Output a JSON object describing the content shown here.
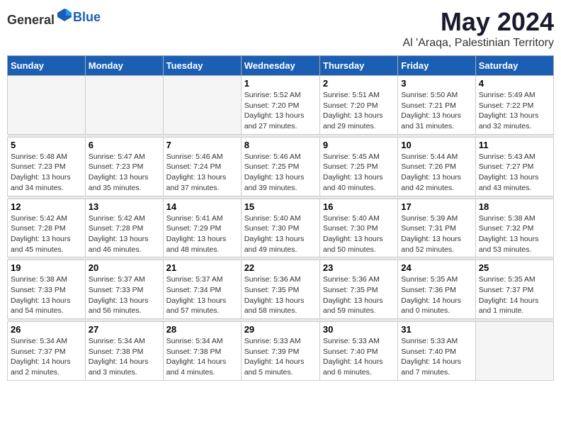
{
  "header": {
    "logo_general": "General",
    "logo_blue": "Blue",
    "title": "May 2024",
    "location": "Al 'Araqa, Palestinian Territory"
  },
  "weekdays": [
    "Sunday",
    "Monday",
    "Tuesday",
    "Wednesday",
    "Thursday",
    "Friday",
    "Saturday"
  ],
  "weeks": [
    [
      {
        "day": "",
        "sunrise": "",
        "sunset": "",
        "daylight": ""
      },
      {
        "day": "",
        "sunrise": "",
        "sunset": "",
        "daylight": ""
      },
      {
        "day": "",
        "sunrise": "",
        "sunset": "",
        "daylight": ""
      },
      {
        "day": "1",
        "sunrise": "Sunrise: 5:52 AM",
        "sunset": "Sunset: 7:20 PM",
        "daylight": "Daylight: 13 hours and 27 minutes."
      },
      {
        "day": "2",
        "sunrise": "Sunrise: 5:51 AM",
        "sunset": "Sunset: 7:20 PM",
        "daylight": "Daylight: 13 hours and 29 minutes."
      },
      {
        "day": "3",
        "sunrise": "Sunrise: 5:50 AM",
        "sunset": "Sunset: 7:21 PM",
        "daylight": "Daylight: 13 hours and 31 minutes."
      },
      {
        "day": "4",
        "sunrise": "Sunrise: 5:49 AM",
        "sunset": "Sunset: 7:22 PM",
        "daylight": "Daylight: 13 hours and 32 minutes."
      }
    ],
    [
      {
        "day": "5",
        "sunrise": "Sunrise: 5:48 AM",
        "sunset": "Sunset: 7:23 PM",
        "daylight": "Daylight: 13 hours and 34 minutes."
      },
      {
        "day": "6",
        "sunrise": "Sunrise: 5:47 AM",
        "sunset": "Sunset: 7:23 PM",
        "daylight": "Daylight: 13 hours and 35 minutes."
      },
      {
        "day": "7",
        "sunrise": "Sunrise: 5:46 AM",
        "sunset": "Sunset: 7:24 PM",
        "daylight": "Daylight: 13 hours and 37 minutes."
      },
      {
        "day": "8",
        "sunrise": "Sunrise: 5:46 AM",
        "sunset": "Sunset: 7:25 PM",
        "daylight": "Daylight: 13 hours and 39 minutes."
      },
      {
        "day": "9",
        "sunrise": "Sunrise: 5:45 AM",
        "sunset": "Sunset: 7:25 PM",
        "daylight": "Daylight: 13 hours and 40 minutes."
      },
      {
        "day": "10",
        "sunrise": "Sunrise: 5:44 AM",
        "sunset": "Sunset: 7:26 PM",
        "daylight": "Daylight: 13 hours and 42 minutes."
      },
      {
        "day": "11",
        "sunrise": "Sunrise: 5:43 AM",
        "sunset": "Sunset: 7:27 PM",
        "daylight": "Daylight: 13 hours and 43 minutes."
      }
    ],
    [
      {
        "day": "12",
        "sunrise": "Sunrise: 5:42 AM",
        "sunset": "Sunset: 7:28 PM",
        "daylight": "Daylight: 13 hours and 45 minutes."
      },
      {
        "day": "13",
        "sunrise": "Sunrise: 5:42 AM",
        "sunset": "Sunset: 7:28 PM",
        "daylight": "Daylight: 13 hours and 46 minutes."
      },
      {
        "day": "14",
        "sunrise": "Sunrise: 5:41 AM",
        "sunset": "Sunset: 7:29 PM",
        "daylight": "Daylight: 13 hours and 48 minutes."
      },
      {
        "day": "15",
        "sunrise": "Sunrise: 5:40 AM",
        "sunset": "Sunset: 7:30 PM",
        "daylight": "Daylight: 13 hours and 49 minutes."
      },
      {
        "day": "16",
        "sunrise": "Sunrise: 5:40 AM",
        "sunset": "Sunset: 7:30 PM",
        "daylight": "Daylight: 13 hours and 50 minutes."
      },
      {
        "day": "17",
        "sunrise": "Sunrise: 5:39 AM",
        "sunset": "Sunset: 7:31 PM",
        "daylight": "Daylight: 13 hours and 52 minutes."
      },
      {
        "day": "18",
        "sunrise": "Sunrise: 5:38 AM",
        "sunset": "Sunset: 7:32 PM",
        "daylight": "Daylight: 13 hours and 53 minutes."
      }
    ],
    [
      {
        "day": "19",
        "sunrise": "Sunrise: 5:38 AM",
        "sunset": "Sunset: 7:33 PM",
        "daylight": "Daylight: 13 hours and 54 minutes."
      },
      {
        "day": "20",
        "sunrise": "Sunrise: 5:37 AM",
        "sunset": "Sunset: 7:33 PM",
        "daylight": "Daylight: 13 hours and 56 minutes."
      },
      {
        "day": "21",
        "sunrise": "Sunrise: 5:37 AM",
        "sunset": "Sunset: 7:34 PM",
        "daylight": "Daylight: 13 hours and 57 minutes."
      },
      {
        "day": "22",
        "sunrise": "Sunrise: 5:36 AM",
        "sunset": "Sunset: 7:35 PM",
        "daylight": "Daylight: 13 hours and 58 minutes."
      },
      {
        "day": "23",
        "sunrise": "Sunrise: 5:36 AM",
        "sunset": "Sunset: 7:35 PM",
        "daylight": "Daylight: 13 hours and 59 minutes."
      },
      {
        "day": "24",
        "sunrise": "Sunrise: 5:35 AM",
        "sunset": "Sunset: 7:36 PM",
        "daylight": "Daylight: 14 hours and 0 minutes."
      },
      {
        "day": "25",
        "sunrise": "Sunrise: 5:35 AM",
        "sunset": "Sunset: 7:37 PM",
        "daylight": "Daylight: 14 hours and 1 minute."
      }
    ],
    [
      {
        "day": "26",
        "sunrise": "Sunrise: 5:34 AM",
        "sunset": "Sunset: 7:37 PM",
        "daylight": "Daylight: 14 hours and 2 minutes."
      },
      {
        "day": "27",
        "sunrise": "Sunrise: 5:34 AM",
        "sunset": "Sunset: 7:38 PM",
        "daylight": "Daylight: 14 hours and 3 minutes."
      },
      {
        "day": "28",
        "sunrise": "Sunrise: 5:34 AM",
        "sunset": "Sunset: 7:38 PM",
        "daylight": "Daylight: 14 hours and 4 minutes."
      },
      {
        "day": "29",
        "sunrise": "Sunrise: 5:33 AM",
        "sunset": "Sunset: 7:39 PM",
        "daylight": "Daylight: 14 hours and 5 minutes."
      },
      {
        "day": "30",
        "sunrise": "Sunrise: 5:33 AM",
        "sunset": "Sunset: 7:40 PM",
        "daylight": "Daylight: 14 hours and 6 minutes."
      },
      {
        "day": "31",
        "sunrise": "Sunrise: 5:33 AM",
        "sunset": "Sunset: 7:40 PM",
        "daylight": "Daylight: 14 hours and 7 minutes."
      },
      {
        "day": "",
        "sunrise": "",
        "sunset": "",
        "daylight": ""
      }
    ]
  ]
}
